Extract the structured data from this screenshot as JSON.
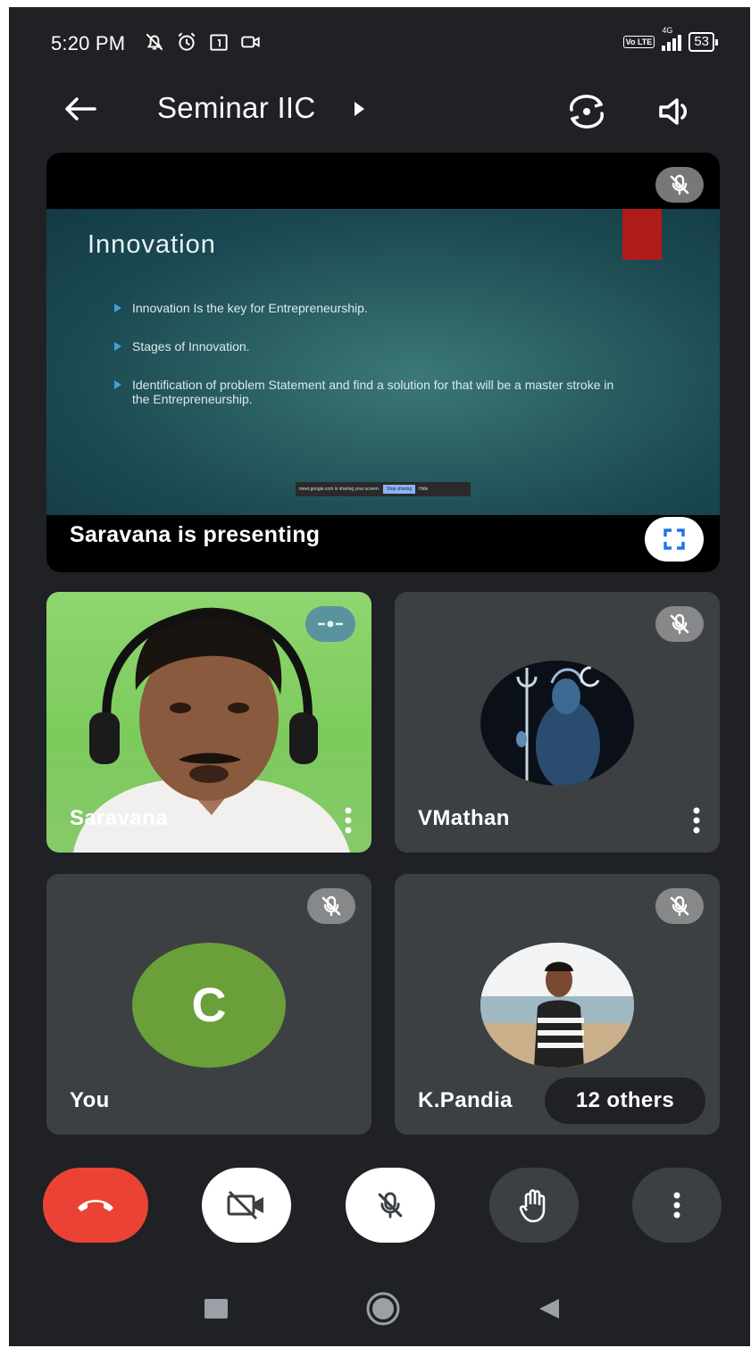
{
  "status_bar": {
    "time": "5:20 PM",
    "network": "4G",
    "lte": "Vo LTE",
    "battery": "53"
  },
  "header": {
    "title": "Seminar IIC"
  },
  "presentation": {
    "slide": {
      "title": "Innovation",
      "bullets": [
        "Innovation Is the key for Entrepreneurship.",
        "Stages of Innovation.",
        "Identification of problem Statement and find a solution for that will be a master stroke in the Entrepreneurship."
      ],
      "share_bar": {
        "text": "meet.google.com is sharing your screen.",
        "stop_label": "Stop sharing",
        "hide_label": "Hide"
      }
    },
    "presenting_label": "Saravana is presenting"
  },
  "participants": [
    {
      "name": "Saravana",
      "kind": "camera"
    },
    {
      "name": "VMathan",
      "kind": "avatar",
      "muted": true
    },
    {
      "name": "You",
      "kind": "initial",
      "initial": "C",
      "muted": true,
      "avatar_color": "#6a9f3a"
    },
    {
      "name": "K.Pandia",
      "kind": "avatar",
      "muted": true,
      "others": "12 others"
    }
  ],
  "colors": {
    "background": "#202124",
    "tile": "#3c4043",
    "end_call": "#ea4335",
    "you_avatar": "#6a9f3a"
  },
  "controls": {
    "icons": [
      "end-call-icon",
      "camera-off-icon",
      "mic-off-icon",
      "raise-hand-icon",
      "more-icon"
    ]
  }
}
